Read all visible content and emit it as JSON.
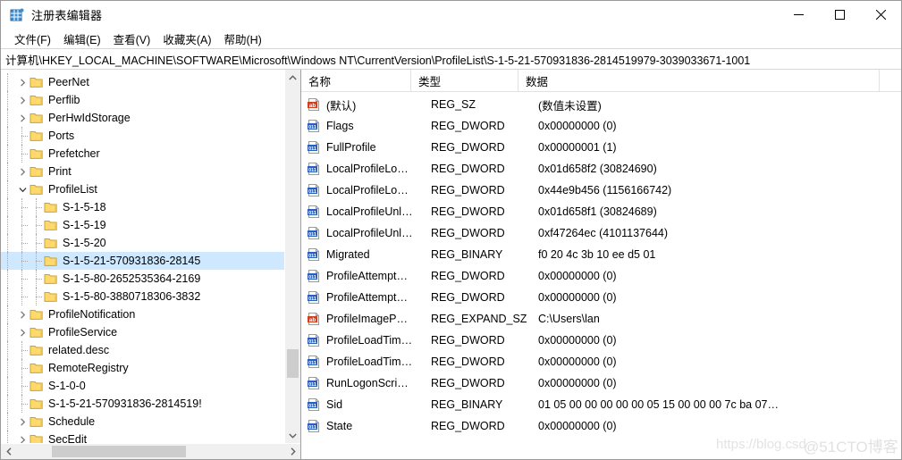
{
  "window": {
    "title": "注册表编辑器",
    "icon": "registry-icon",
    "controls": {
      "minimize": "minimize-icon",
      "maximize": "maximize-icon",
      "close": "close-icon"
    }
  },
  "menubar": {
    "items": [
      {
        "label": "文件(F)"
      },
      {
        "label": "编辑(E)"
      },
      {
        "label": "查看(V)"
      },
      {
        "label": "收藏夹(A)"
      },
      {
        "label": "帮助(H)"
      }
    ]
  },
  "address": {
    "path": "计算机\\HKEY_LOCAL_MACHINE\\SOFTWARE\\Microsoft\\Windows NT\\CurrentVersion\\ProfileList\\S-1-5-21-570931836-2814519979-3039033671-1001"
  },
  "tree": {
    "rows": [
      {
        "label": "PeerNet",
        "indent": 1,
        "expander": "collapsed",
        "selected": false
      },
      {
        "label": "Perflib",
        "indent": 1,
        "expander": "collapsed",
        "selected": false
      },
      {
        "label": "PerHwIdStorage",
        "indent": 1,
        "expander": "collapsed",
        "selected": false
      },
      {
        "label": "Ports",
        "indent": 1,
        "expander": "none",
        "selected": false
      },
      {
        "label": "Prefetcher",
        "indent": 1,
        "expander": "none",
        "selected": false
      },
      {
        "label": "Print",
        "indent": 1,
        "expander": "collapsed",
        "selected": false
      },
      {
        "label": "ProfileList",
        "indent": 1,
        "expander": "expanded",
        "selected": false
      },
      {
        "label": "S-1-5-18",
        "indent": 2,
        "expander": "none",
        "selected": false
      },
      {
        "label": "S-1-5-19",
        "indent": 2,
        "expander": "none",
        "selected": false
      },
      {
        "label": "S-1-5-20",
        "indent": 2,
        "expander": "none",
        "selected": false
      },
      {
        "label": "S-1-5-21-570931836-28145",
        "indent": 2,
        "expander": "none",
        "selected": true
      },
      {
        "label": "S-1-5-80-2652535364-2169",
        "indent": 2,
        "expander": "none",
        "selected": false
      },
      {
        "label": "S-1-5-80-3880718306-3832",
        "indent": 2,
        "expander": "none",
        "selected": false
      },
      {
        "label": "ProfileNotification",
        "indent": 1,
        "expander": "collapsed",
        "selected": false
      },
      {
        "label": "ProfileService",
        "indent": 1,
        "expander": "collapsed",
        "selected": false
      },
      {
        "label": "related.desc",
        "indent": 1,
        "expander": "none",
        "selected": false
      },
      {
        "label": "RemoteRegistry",
        "indent": 1,
        "expander": "none",
        "selected": false
      },
      {
        "label": "S-1-0-0",
        "indent": 1,
        "expander": "none",
        "selected": false
      },
      {
        "label": "S-1-5-21-570931836-2814519!",
        "indent": 1,
        "expander": "none",
        "selected": false
      },
      {
        "label": "Schedule",
        "indent": 1,
        "expander": "collapsed",
        "selected": false
      },
      {
        "label": "SecEdit",
        "indent": 1,
        "expander": "collapsed",
        "selected": false
      }
    ],
    "scrollbar_vertical": {
      "up": "scroll-up-icon",
      "down": "scroll-down-icon"
    },
    "scrollbar_horizontal": {
      "left": "scroll-left-icon",
      "right": "scroll-right-icon"
    }
  },
  "values": {
    "columns": [
      {
        "label": "名称"
      },
      {
        "label": "类型"
      },
      {
        "label": "数据"
      }
    ],
    "rows": [
      {
        "icon": "string-value-icon",
        "name": "(默认)",
        "type": "REG_SZ",
        "data": "(数值未设置)"
      },
      {
        "icon": "binary-value-icon",
        "name": "Flags",
        "type": "REG_DWORD",
        "data": "0x00000000 (0)"
      },
      {
        "icon": "binary-value-icon",
        "name": "FullProfile",
        "type": "REG_DWORD",
        "data": "0x00000001 (1)"
      },
      {
        "icon": "binary-value-icon",
        "name": "LocalProfileLo…",
        "type": "REG_DWORD",
        "data": "0x01d658f2 (30824690)"
      },
      {
        "icon": "binary-value-icon",
        "name": "LocalProfileLo…",
        "type": "REG_DWORD",
        "data": "0x44e9b456 (1156166742)"
      },
      {
        "icon": "binary-value-icon",
        "name": "LocalProfileUnl…",
        "type": "REG_DWORD",
        "data": "0x01d658f1 (30824689)"
      },
      {
        "icon": "binary-value-icon",
        "name": "LocalProfileUnl…",
        "type": "REG_DWORD",
        "data": "0xf47264ec (4101137644)"
      },
      {
        "icon": "binary-value-icon",
        "name": "Migrated",
        "type": "REG_BINARY",
        "data": "f0 20 4c 3b 10 ee d5 01"
      },
      {
        "icon": "binary-value-icon",
        "name": "ProfileAttempt…",
        "type": "REG_DWORD",
        "data": "0x00000000 (0)"
      },
      {
        "icon": "binary-value-icon",
        "name": "ProfileAttempt…",
        "type": "REG_DWORD",
        "data": "0x00000000 (0)"
      },
      {
        "icon": "string-value-icon",
        "name": "ProfileImageP…",
        "type": "REG_EXPAND_SZ",
        "data": "C:\\Users\\lan"
      },
      {
        "icon": "binary-value-icon",
        "name": "ProfileLoadTim…",
        "type": "REG_DWORD",
        "data": "0x00000000 (0)"
      },
      {
        "icon": "binary-value-icon",
        "name": "ProfileLoadTim…",
        "type": "REG_DWORD",
        "data": "0x00000000 (0)"
      },
      {
        "icon": "binary-value-icon",
        "name": "RunLogonScri…",
        "type": "REG_DWORD",
        "data": "0x00000000 (0)"
      },
      {
        "icon": "binary-value-icon",
        "name": "Sid",
        "type": "REG_BINARY",
        "data": "01 05 00 00 00 00 00 05 15 00 00 00 7c ba 07…"
      },
      {
        "icon": "binary-value-icon",
        "name": "State",
        "type": "REG_DWORD",
        "data": "0x00000000 (0)"
      }
    ]
  },
  "watermark": {
    "url": "https://blog.csd",
    "site": "@51CTO博客"
  },
  "colors": {
    "selection": "#cde8ff",
    "folder": "#ffd96e",
    "string_icon": "#d23f1f",
    "binary_icon": "#2b5fb8",
    "accent": "#0078d7"
  }
}
